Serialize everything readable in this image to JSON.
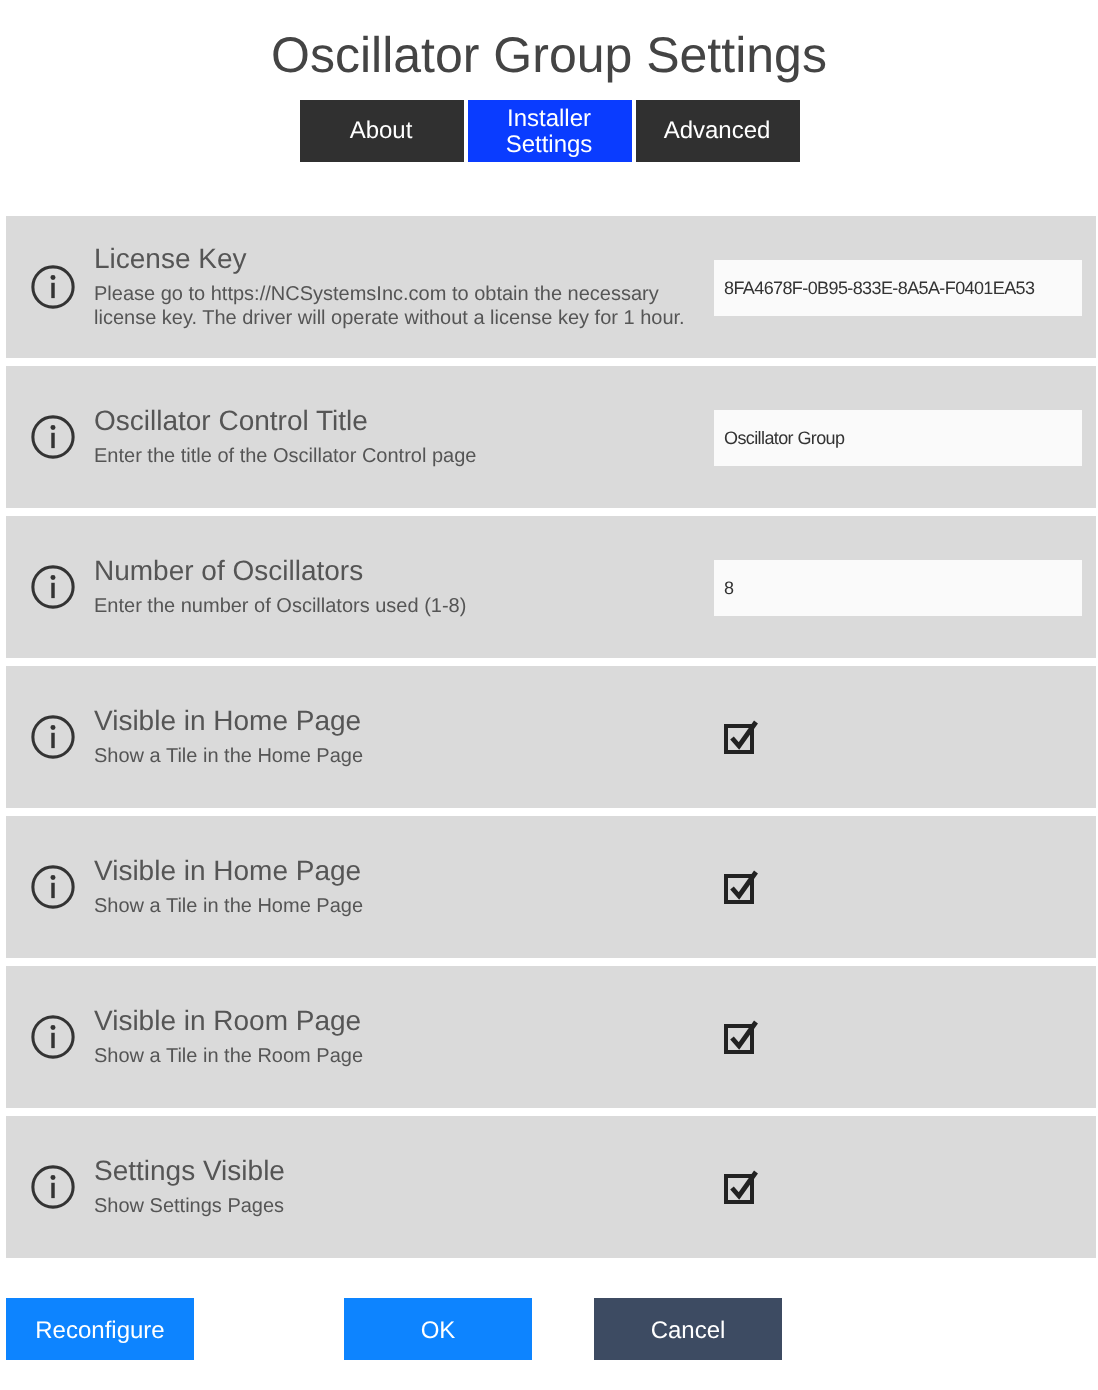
{
  "title": "Oscillator Group Settings",
  "tabs": [
    {
      "label": "About",
      "selected": false
    },
    {
      "label": "Installer Settings",
      "selected": true
    },
    {
      "label": "Advanced",
      "selected": false
    }
  ],
  "settings": [
    {
      "kind": "text",
      "title": "License Key",
      "description": "Please go to https://NCSystemsInc.com to obtain the necessary license key. The driver will operate without a license key for 1 hour.",
      "value": "8FA4678F-0B95-833E-8A5A-F0401EA53"
    },
    {
      "kind": "text",
      "title": "Oscillator Control Title",
      "description": "Enter the title of the Oscillator Control page",
      "value": "Oscillator Group"
    },
    {
      "kind": "text",
      "title": "Number of Oscillators",
      "description": "Enter the number of Oscillators used (1-8)",
      "value": "8"
    },
    {
      "kind": "checkbox",
      "title": "Visible in Home Page",
      "description": "Show a Tile in the Home Page",
      "checked": true
    },
    {
      "kind": "checkbox",
      "title": "Visible in Home Page",
      "description": "Show a Tile in the Home Page",
      "checked": true
    },
    {
      "kind": "checkbox",
      "title": "Visible in Room Page",
      "description": "Show a Tile in the Room Page",
      "checked": true
    },
    {
      "kind": "checkbox",
      "title": "Settings Visible",
      "description": "Show Settings Pages",
      "checked": true
    }
  ],
  "buttons": [
    {
      "label": "Reconfigure",
      "kind": "primary"
    },
    {
      "label": "OK",
      "kind": "primary"
    },
    {
      "label": "Cancel",
      "kind": "secondary"
    }
  ]
}
